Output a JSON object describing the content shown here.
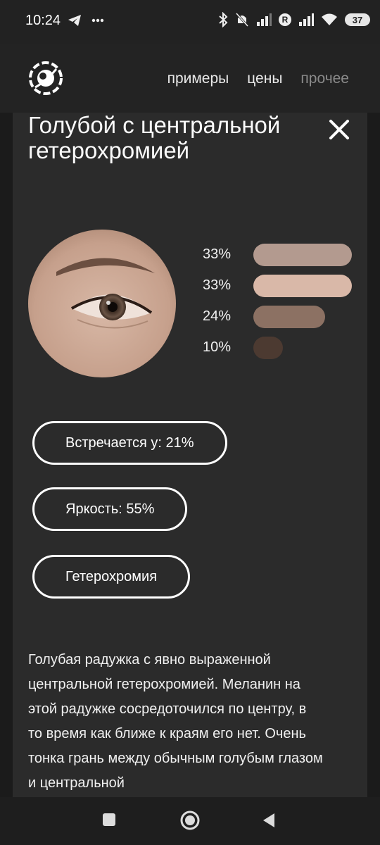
{
  "status_bar": {
    "time": "10:24",
    "battery": "37",
    "carrier_badge": "R"
  },
  "header": {
    "nav": [
      {
        "label": "примеры"
      },
      {
        "label": "цены"
      },
      {
        "label": "прочее"
      }
    ]
  },
  "modal": {
    "title": "Голубой с центральной гетерохромией",
    "palette": [
      {
        "percent": "33%",
        "value": 33,
        "color": "#b39a8f"
      },
      {
        "percent": "33%",
        "value": 33,
        "color": "#d9b8a8"
      },
      {
        "percent": "24%",
        "value": 24,
        "color": "#8c7163"
      },
      {
        "percent": "10%",
        "value": 10,
        "color": "#4c3a31"
      }
    ],
    "tags": {
      "frequency": "Встречается у: 21%",
      "brightness": "Яркость: 55%",
      "type": "Гетерохромия"
    },
    "description": "Голубая радужка с явно выраженной центральной гетерохромией. Меланин на этой радужке сосредоточился по центру, в то время как ближе к краям его нет. Очень тонка грань между обычным голубым глазом и центральной"
  },
  "colors": {
    "background": "#262626",
    "modal": "#2b2b2b",
    "text": "#ffffff"
  }
}
